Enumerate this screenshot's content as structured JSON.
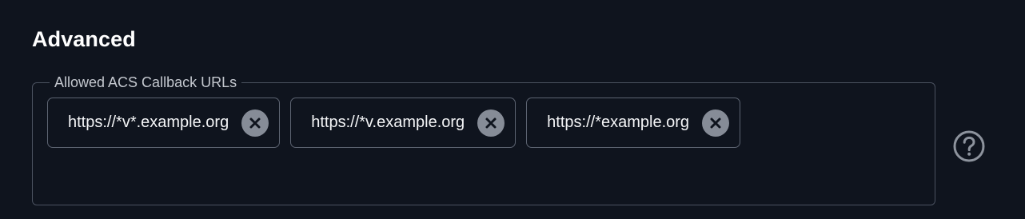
{
  "section": {
    "title": "Advanced"
  },
  "acs_field": {
    "label": "Allowed ACS Callback URLs",
    "values": [
      {
        "text": "https://*v*.example.org"
      },
      {
        "text": "https://*v.example.org"
      },
      {
        "text": "https://*example.org"
      }
    ],
    "remove_icon": "close-circle-icon",
    "help_icon": "help-circle-icon"
  },
  "colors": {
    "background": "#0f141e",
    "text": "#ffffff",
    "border": "#4b5260",
    "chip_remove": "#868c97"
  }
}
